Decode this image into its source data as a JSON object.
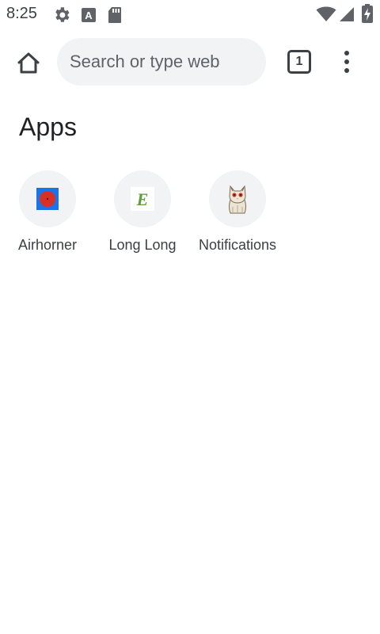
{
  "status_bar": {
    "time": "8:25",
    "icons": [
      "settings-icon",
      "keyboard-icon",
      "sd-card-icon",
      "wifi-icon",
      "signal-icon",
      "battery-charging-icon"
    ]
  },
  "toolbar": {
    "home_icon": "home-icon",
    "search_placeholder": "Search or type web address",
    "tab_count": "1",
    "menu_icon": "more-vert-icon"
  },
  "apps": {
    "title": "Apps",
    "items": [
      {
        "label": "Airhorner",
        "icon": "airhorner-icon",
        "colors": {
          "bg": "#1a73e8",
          "fg": "#d93025"
        }
      },
      {
        "label": "Long Long",
        "icon": "long-long-icon",
        "colors": {
          "fg": "#5f9e3a"
        }
      },
      {
        "label": "Notifications",
        "icon": "cat-icon"
      }
    ]
  }
}
